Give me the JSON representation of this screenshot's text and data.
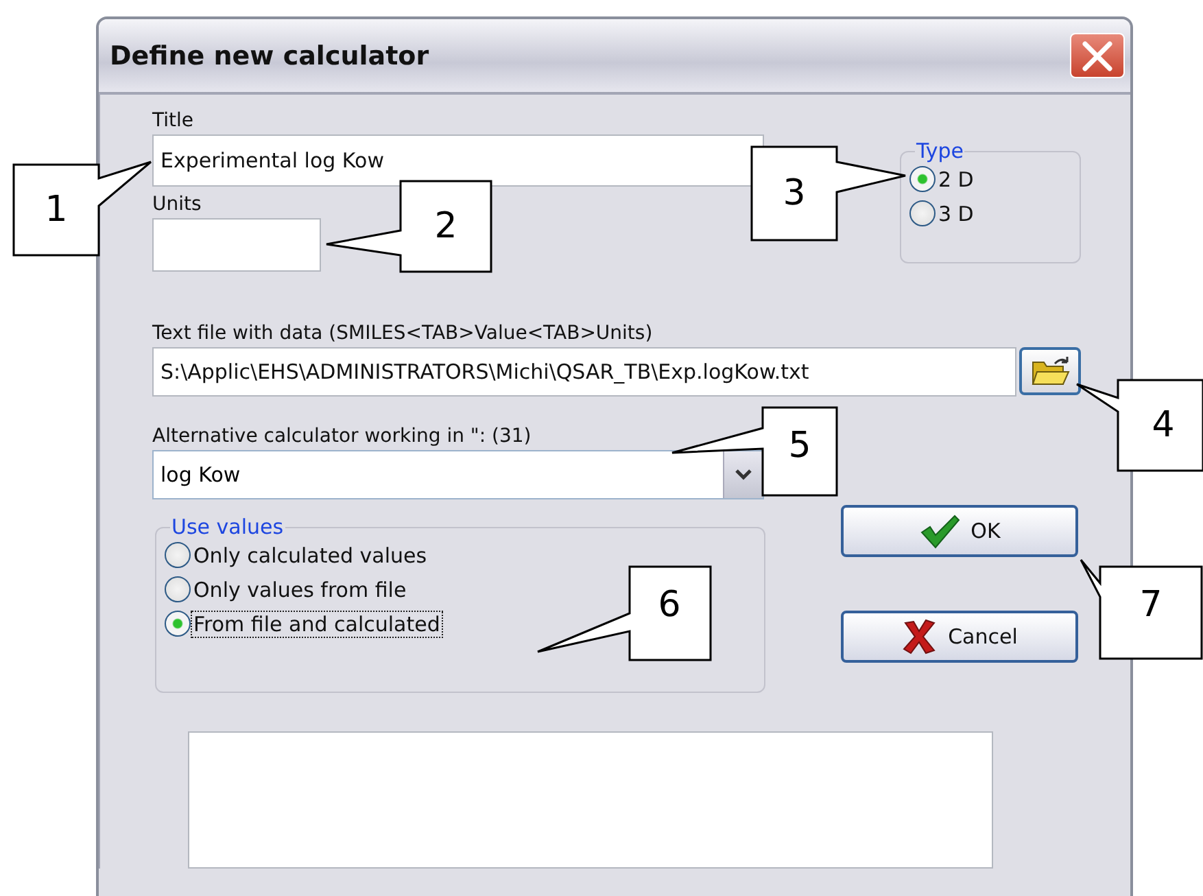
{
  "window": {
    "title": "Define new calculator"
  },
  "title_field": {
    "label": "Title",
    "value": "Experimental log Kow"
  },
  "units_field": {
    "label": "Units"
  },
  "type_group": {
    "legend": "Type",
    "options": [
      {
        "label": "2 D",
        "selected": true
      },
      {
        "label": "3 D",
        "selected": false
      }
    ]
  },
  "data_file": {
    "label": "Text file with data (SMILES<TAB>Value<TAB>Units)",
    "value": "S:\\Applic\\EHS\\ADMINISTRATORS\\Michi\\QSAR_TB\\Exp.logKow.txt"
  },
  "alternative": {
    "label": "Alternative calculator working in \": (31)",
    "value": "log Kow"
  },
  "use_values": {
    "legend": "Use values",
    "options": [
      {
        "label": "Only calculated values",
        "selected": false,
        "focused": false
      },
      {
        "label": "Only values from file",
        "selected": false,
        "focused": false
      },
      {
        "label": "From file and calculated",
        "selected": true,
        "focused": true
      }
    ]
  },
  "buttons": [
    {
      "label": "OK",
      "kind": "ok"
    },
    {
      "label": "Cancel",
      "kind": "cancel"
    }
  ],
  "callouts": [
    {
      "label": "1"
    },
    {
      "label": "2"
    },
    {
      "label": "3"
    },
    {
      "label": "4"
    },
    {
      "label": "5"
    },
    {
      "label": "6"
    },
    {
      "label": "7"
    }
  ]
}
